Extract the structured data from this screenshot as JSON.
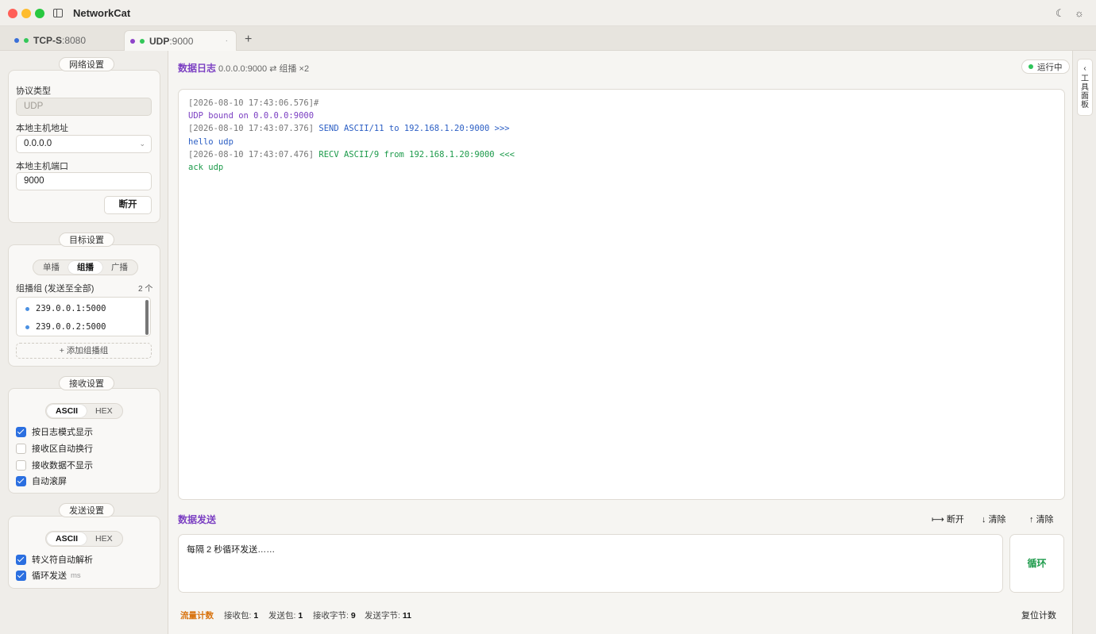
{
  "app": {
    "title": "NetworkCat"
  },
  "titlebar": {
    "theme_icon": "☾",
    "settings_icon": "☼"
  },
  "tabs": [
    {
      "name": "TCP-S",
      "port": " :8080",
      "dot1": "#3a6fd8",
      "dot2": "#34c759"
    },
    {
      "name": "UDP",
      "port": " :9000",
      "dot1": "#8e44c9",
      "dot2": "#34c759",
      "close": "·"
    }
  ],
  "tab_add": "+",
  "network": {
    "title": "网络设置",
    "protocol_label": "协议类型",
    "protocol_value": "UDP",
    "host_label": "本地主机地址",
    "host_value": "0.0.0.0",
    "port_label": "本地主机端口",
    "port_value": "9000",
    "disconnect": "断开"
  },
  "target": {
    "title": "目标设置",
    "modes": [
      "单播",
      "组播",
      "广播"
    ],
    "group_label": "组播组 (发送至全部)",
    "group_count": "2 个",
    "groups": [
      "239.0.0.1:5000",
      "239.0.0.2:5000"
    ],
    "add_group": "+ 添加组播组"
  },
  "receive": {
    "title": "接收设置",
    "modes": [
      "ASCII",
      "HEX"
    ],
    "options": [
      {
        "label": "按日志模式显示",
        "checked": true
      },
      {
        "label": "接收区自动换行",
        "checked": false
      },
      {
        "label": "接收数据不显示",
        "checked": false
      },
      {
        "label": "自动滚屏",
        "checked": true
      }
    ]
  },
  "send_settings": {
    "title": "发送设置",
    "modes": [
      "ASCII",
      "HEX"
    ],
    "options": [
      {
        "label": "转义符自动解析",
        "checked": true
      },
      {
        "label": "循环发送",
        "checked": true,
        "unit": "ms"
      }
    ]
  },
  "log": {
    "title": "数据日志",
    "subinfo": "0.0.0.0:9000 ⇄ 组播 ×2",
    "status": "运行中",
    "lines": [
      {
        "ts": "[2026-08-10 17:43:06.576]",
        "text": "#",
        "cls": "ts"
      },
      {
        "ts": "",
        "text": "UDP bound on 0.0.0.0:9000",
        "cls": "purple"
      },
      {
        "ts": "[2026-08-10 17:43:07.376]",
        "text": " SEND ASCII/11 to 192.168.1.20:9000 >>>",
        "cls": "blue"
      },
      {
        "ts": "",
        "text": "hello udp",
        "cls": "blue"
      },
      {
        "ts": "[2026-08-10 17:43:07.476]",
        "text": " RECV ASCII/9 from 192.168.1.20:9000 <<<",
        "cls": "green"
      },
      {
        "ts": "",
        "text": "ack udp",
        "cls": "green"
      }
    ]
  },
  "send": {
    "title": "数据发送",
    "actions": [
      {
        "icon": "⟼",
        "label": "断开"
      },
      {
        "icon": "↓",
        "label": "清除"
      },
      {
        "icon": "↑",
        "label": "清除"
      }
    ],
    "text": "每隔 2 秒循环发送……",
    "loop_button": "循环"
  },
  "stats": {
    "title": "流量计数",
    "items": [
      {
        "label": "接收包: ",
        "value": "1"
      },
      {
        "label": "发送包: ",
        "value": "1"
      },
      {
        "label": "接收字节: ",
        "value": "9"
      },
      {
        "label": "发送字节: ",
        "value": "11"
      }
    ],
    "reset": "复位计数"
  },
  "tool_panel": {
    "arrow": "‹",
    "label": "工具面板"
  }
}
